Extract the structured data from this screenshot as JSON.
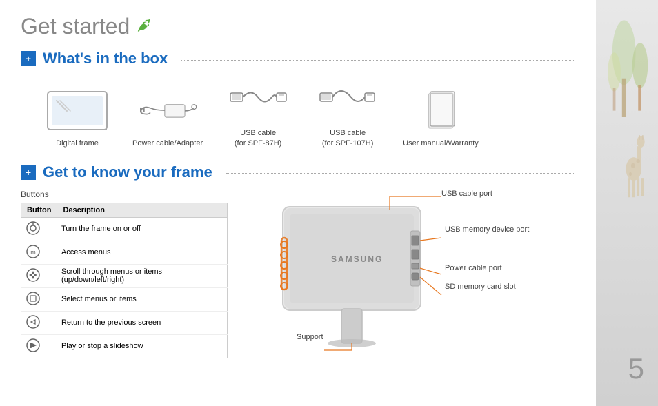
{
  "page": {
    "title": "Get started",
    "leaf_icon": "🌿",
    "page_number": "5"
  },
  "section1": {
    "icon": "+",
    "title": "What's in the box",
    "items": [
      {
        "label": "Digital frame",
        "type": "frame"
      },
      {
        "label": "Power cable/Adapter",
        "type": "power"
      },
      {
        "label": "USB cable\n(for SPF-87H)",
        "type": "usb1"
      },
      {
        "label": "USB cable\n(for SPF-107H)",
        "type": "usb2"
      },
      {
        "label": "User manual/Warranty",
        "type": "manual"
      }
    ]
  },
  "section2": {
    "icon": "+",
    "title": "Get to know your frame",
    "buttons_label": "Buttons",
    "table_headers": [
      "Button",
      "Description"
    ],
    "table_rows": [
      {
        "icon": "power",
        "desc": "Turn the frame on or off"
      },
      {
        "icon": "menu",
        "desc": "Access menus"
      },
      {
        "icon": "scroll",
        "desc": "Scroll through menus or items (up/down/left/right)"
      },
      {
        "icon": "select",
        "desc": "Select menus or items"
      },
      {
        "icon": "back",
        "desc": "Return to the previous screen"
      },
      {
        "icon": "play",
        "desc": "Play or stop a slideshow"
      }
    ],
    "callouts": [
      {
        "label": "USB cable port",
        "position": "top"
      },
      {
        "label": "USB memory device port",
        "position": "right-top"
      },
      {
        "label": "Power cable port",
        "position": "right-mid"
      },
      {
        "label": "SD memory card slot",
        "position": "right-bot"
      },
      {
        "label": "Support",
        "position": "bottom"
      }
    ]
  }
}
